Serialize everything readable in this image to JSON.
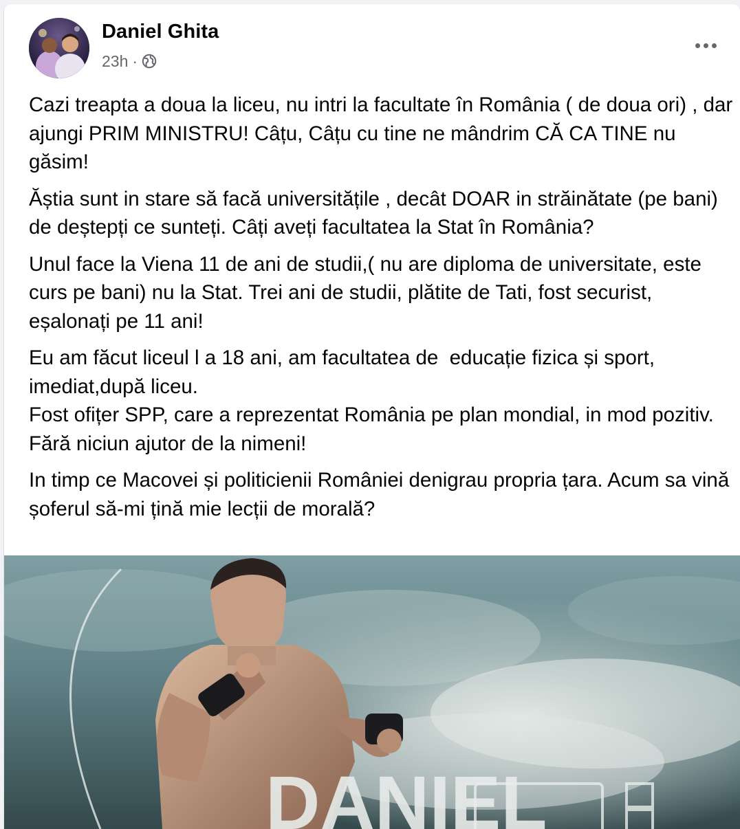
{
  "post": {
    "author": "Daniel Ghita",
    "time": "23h",
    "separator": "·",
    "privacy_icon": "globe-icon",
    "more_icon": "more-horizontal-icon",
    "paragraphs": [
      "Cazi treapta a doua la liceu, nu intri la facultate în România ( de doua ori) , dar ajungi PRIM MINISTRU! Câțu, Câțu cu tine ne mândrim CĂ CA TINE nu găsim!",
      "Ăștia sunt in stare să facă universitățile , decât DOAR in străinătate (pe bani) de deștepți ce sunteți. Câți aveți facultatea la Stat în România?",
      "Unul face la Viena 11 de ani de studii,( nu are diploma de universitate, este curs pe bani) nu la Stat. Trei ani de studii, plătite de Tati, fost securist, eșalonați pe 11 ani!",
      "Eu am făcut liceul l a 18 ani, am facultatea de  educație fizica și sport, imediat,după liceu.\nFost ofițer SPP, care a reprezentat România pe plan mondial, in mod pozitiv. Fără niciun ajutor de la nimeni!",
      "In timp ce Macovei și politicienii României denigrau propria țara. Acum sa vină șoferul să-mi țină mie lecții de morală?"
    ]
  },
  "colors": {
    "secondary_text": "#65676b",
    "primary_text": "#050505"
  }
}
